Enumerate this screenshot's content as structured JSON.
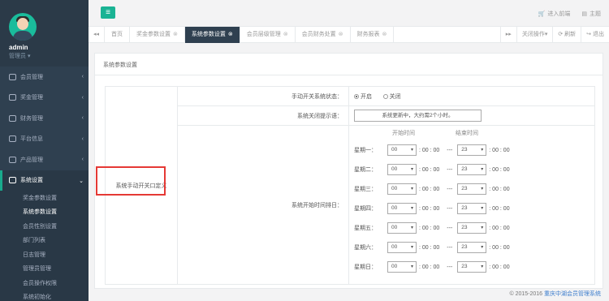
{
  "profile": {
    "name": "admin",
    "role": "管理员 ▾"
  },
  "sidebar": {
    "items": [
      {
        "label": "会员管理",
        "icon": "users-icon"
      },
      {
        "label": "奖金管理",
        "icon": "coin-icon"
      },
      {
        "label": "财务管理",
        "icon": "wallet-icon"
      },
      {
        "label": "平台信息",
        "icon": "info-icon"
      },
      {
        "label": "产品管理",
        "icon": "grid-icon"
      },
      {
        "label": "系统设置",
        "icon": "settings-icon"
      }
    ],
    "subitems": [
      "奖金参数设置",
      "系统参数设置",
      "会员性别设置",
      "部门列表",
      "日志管理",
      "管理员管理",
      "会员操作权限",
      "系统初始化"
    ]
  },
  "topbar": {
    "enter_frontend": "进入前端",
    "theme": "主题"
  },
  "tabs": [
    {
      "label": "首页"
    },
    {
      "label": "奖金参数设置"
    },
    {
      "label": "系统参数设置"
    },
    {
      "label": "会员层级管理"
    },
    {
      "label": "会员财务处置"
    },
    {
      "label": "财务报表"
    }
  ],
  "tab_actions": {
    "close_ops": "关闭操作▾",
    "refresh": "刷新",
    "exit": "退出"
  },
  "content": {
    "title": "系统参数设置",
    "left_label": "系统手动开关口定义",
    "rows": {
      "manual_switch_label": "手动开关系统状态：",
      "opt_on": "开启",
      "opt_off": "关闭",
      "close_msg_label": "系统关闭提示语：",
      "close_msg_value": "系统更新中，大约需2个小时。",
      "schedule_label": "系统开始时间排日：",
      "start_head": "开始时间",
      "end_head": "结束时间"
    },
    "days": [
      {
        "day": "星期一：",
        "start": "00",
        "end": "23"
      },
      {
        "day": "星期二：",
        "start": "00",
        "end": "23"
      },
      {
        "day": "星期三：",
        "start": "00",
        "end": "23"
      },
      {
        "day": "星期四：",
        "start": "00",
        "end": "23"
      },
      {
        "day": "星期五：",
        "start": "00",
        "end": "23"
      },
      {
        "day": "星期六：",
        "start": "00",
        "end": "23"
      },
      {
        "day": "星期日：",
        "start": "00",
        "end": "23"
      }
    ],
    "min_sec": ": 00 : 00",
    "sep": "---"
  },
  "footer": {
    "copyright": "© 2015-2016",
    "link": "重庆中湖会员管理系统"
  }
}
